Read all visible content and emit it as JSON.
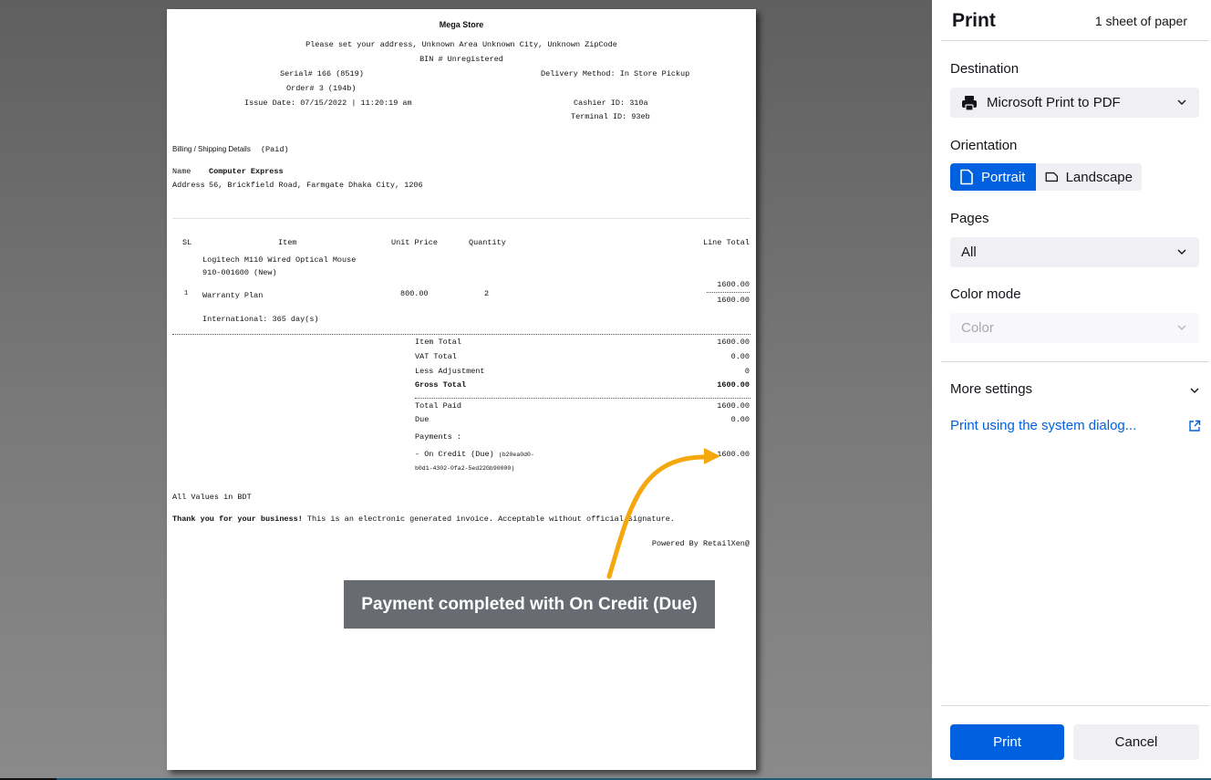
{
  "invoice": {
    "store_name": "Mega Store",
    "address_line": "Please set your address, Unknown Area Unknown City, Unknown ZipCode",
    "bin_line": "BIN # Unregistered",
    "serial": "Serial# 166 (8519)",
    "order": "Order# 3 (194b)",
    "issue_date": "Issue Date: 07/15/2022 | 11:20:19 am",
    "delivery_method": "Delivery Method: In Store Pickup",
    "cashier_id": "Cashier ID: 310a",
    "terminal_id": "Terminal ID: 93eb",
    "billing_label": "Billing / Shipping Details",
    "billing_status": "(Paid)",
    "name_label": "Name",
    "name_value": "Computer Express",
    "address_label": "Address",
    "address_value": "56, Brickfield Road, Farmgate Dhaka City, 1206",
    "table_headers": {
      "sl": "SL",
      "item": "Item",
      "unit_price": "Unit Price",
      "quantity": "Quantity",
      "line_total": "Line Total"
    },
    "items": [
      {
        "sl": "1",
        "name": "Logitech M110 Wired Optical Mouse",
        "sku": "910-001600 (New)",
        "warranty": "Warranty Plan",
        "warranty_detail": "International: 365 day(s)",
        "unit_price": "800.00",
        "quantity": "2",
        "line_total_top": "1600.00",
        "line_total_bottom": "1600.00"
      }
    ],
    "summary": [
      {
        "label": "Item Total",
        "value": "1600.00"
      },
      {
        "label": "VAT Total",
        "value": "0.00"
      },
      {
        "label": "Less Adjustment",
        "value": "0"
      },
      {
        "label": "Gross Total",
        "value": "1600.00"
      }
    ],
    "paid": [
      {
        "label": "Total Paid",
        "value": "1600.00"
      },
      {
        "label": "Due",
        "value": "0.00"
      }
    ],
    "payments_label": "Payments :",
    "payment_method": "- On Credit (Due)",
    "payment_ref_1": "(b20ea0d0-",
    "payment_ref_2": "b0d1-4302-0fa2-5ed22Gb90000)",
    "payment_amount": "1600.00",
    "currency_note": "All Values in BDT",
    "thanks_bold": "Thank you for your business!",
    "thanks_rest": " This is an electronic generated invoice. Acceptable without official signature.",
    "powered_by": "Powered By RetailXen@"
  },
  "annotation": {
    "callout_text": "Payment completed with On Credit (Due)",
    "arrow_color": "#f5a70e",
    "callout_bg": "#686b72"
  },
  "print_panel": {
    "title": "Print",
    "sheet_count": "1 sheet of paper",
    "destination_label": "Destination",
    "destination_value": "Microsoft Print to PDF",
    "orientation_label": "Orientation",
    "orientation_options": [
      "Portrait",
      "Landscape"
    ],
    "orientation_selected": "Portrait",
    "pages_label": "Pages",
    "pages_value": "All",
    "color_mode_label": "Color mode",
    "color_mode_value": "Color",
    "more_settings": "More settings",
    "system_dialog_link": "Print using the system dialog...",
    "print_button": "Print",
    "cancel_button": "Cancel",
    "accent_color": "#0061e0"
  }
}
